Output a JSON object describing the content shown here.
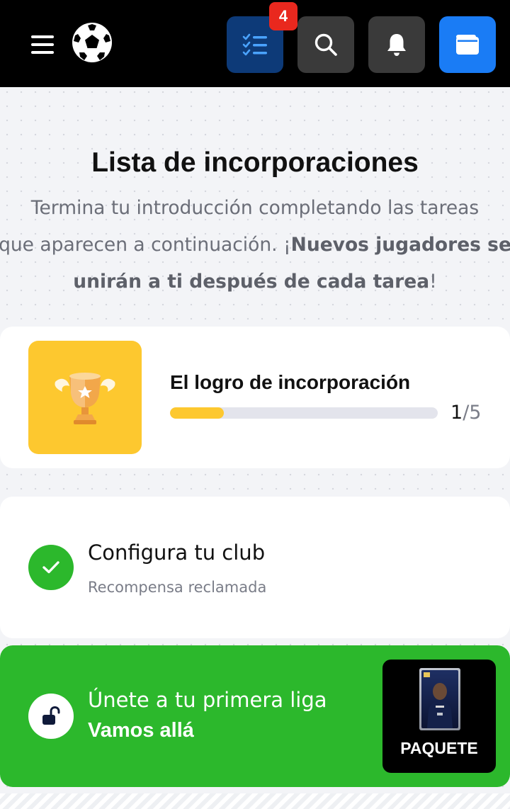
{
  "header": {
    "menu_icon": "hamburger-menu-icon",
    "logo_icon": "soccer-ball-logo-icon",
    "tasks_badge": "4",
    "icons": [
      "checklist-icon",
      "search-icon",
      "bell-icon",
      "wallet-icon"
    ],
    "colors": {
      "tasks_bg": "#0d3a78",
      "wallet_bg": "#1a7cf5",
      "badge_bg": "#e9281e"
    }
  },
  "onboarding": {
    "title": "Lista de incorporaciones",
    "intro_line1": "Termina tu introducción completando las tareas",
    "intro_line2_plain": "que aparecen a continuación. ¡",
    "intro_line2_bold": "Nuevos jugadores se",
    "intro_line3_bold": "unirán a ti después de cada tarea",
    "intro_line3_end": "!"
  },
  "achievement": {
    "title": "El logro de incorporación",
    "progress_current": "1",
    "progress_total": "/5",
    "progress_fraction": 0.2,
    "icon": "trophy-icon",
    "color": "#fdc82f"
  },
  "tasks": [
    {
      "title": "Configura tu club",
      "subtitle": "Recompensa reclamada",
      "status_icon": "check-icon",
      "status_color": "#2cb82c"
    },
    {
      "title": "Únete a tu primera liga",
      "cta": "Vamos allá",
      "status_icon": "unlock-icon",
      "reward_label": "PAQUETE",
      "reward_icon": "player-card-icon",
      "bg_color": "#2cb82c"
    }
  ]
}
